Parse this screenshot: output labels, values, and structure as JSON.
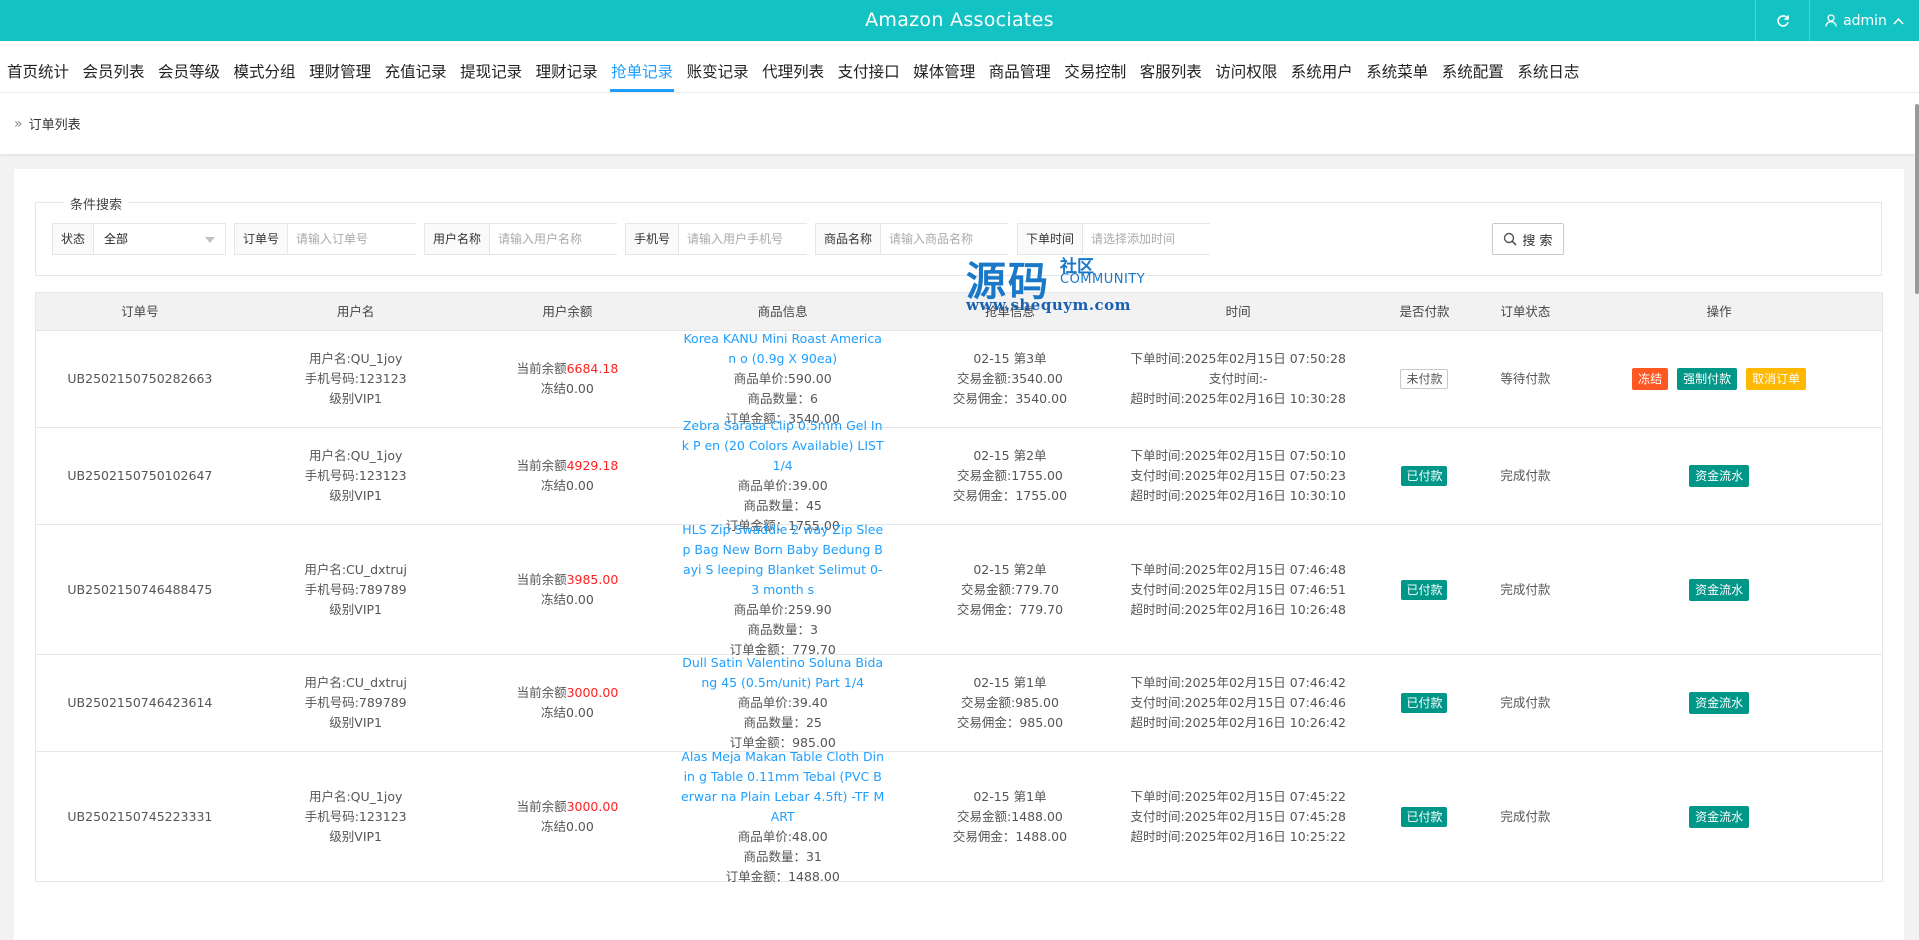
{
  "header": {
    "title": "Amazon Associates",
    "admin": "admin"
  },
  "nav": [
    {
      "label": "首页统计",
      "name": "nav-home-stats"
    },
    {
      "label": "会员列表",
      "name": "nav-member-list"
    },
    {
      "label": "会员等级",
      "name": "nav-member-level"
    },
    {
      "label": "模式分组",
      "name": "nav-mode-group"
    },
    {
      "label": "理财管理",
      "name": "nav-finance-manage"
    },
    {
      "label": "充值记录",
      "name": "nav-recharge-records"
    },
    {
      "label": "提现记录",
      "name": "nav-withdraw-records"
    },
    {
      "label": "理财记录",
      "name": "nav-finance-records"
    },
    {
      "label": "抢单记录",
      "name": "nav-grab-records",
      "active": true
    },
    {
      "label": "账变记录",
      "name": "nav-account-change"
    },
    {
      "label": "代理列表",
      "name": "nav-agent-list"
    },
    {
      "label": "支付接口",
      "name": "nav-payment-api"
    },
    {
      "label": "媒体管理",
      "name": "nav-media-manage"
    },
    {
      "label": "商品管理",
      "name": "nav-goods-manage"
    },
    {
      "label": "交易控制",
      "name": "nav-trade-control"
    },
    {
      "label": "客服列表",
      "name": "nav-service-list"
    },
    {
      "label": "访问权限",
      "name": "nav-access-rights"
    },
    {
      "label": "系统用户",
      "name": "nav-system-users"
    },
    {
      "label": "系统菜单",
      "name": "nav-system-menu"
    },
    {
      "label": "系统配置",
      "name": "nav-system-config"
    },
    {
      "label": "系统日志",
      "name": "nav-system-log"
    }
  ],
  "breadcrumb": "订单列表",
  "search": {
    "legend": "条件搜索",
    "status_label": "状态",
    "status_value": "全部",
    "order_label": "订单号",
    "order_placeholder": "请输入订单号",
    "username_label": "用户名称",
    "username_placeholder": "请输入用户名称",
    "phone_label": "手机号",
    "phone_placeholder": "请输入用户手机号",
    "goods_label": "商品名称",
    "goods_placeholder": "请输入商品名称",
    "time_label": "下单时间",
    "time_placeholder": "请选择添加时间",
    "button": "搜 索"
  },
  "table": {
    "headers": [
      "订单号",
      "用户名",
      "用户余额",
      "商品信息",
      "抢单信息",
      "时间",
      "是否付款",
      "订单状态",
      "操作"
    ],
    "rows": [
      {
        "order_no": "UB2502150750282663",
        "user": [
          "用户名:QU_1joy",
          "手机号码:123123",
          "级别VIP1"
        ],
        "balance_prefix": "当前余额",
        "balance": "6684.18",
        "frozen": "冻结0.00",
        "goods_name": "Korea KANU Mini Roast American o (0.9g X 90ea)",
        "goods_info": [
          "商品单价:590.00",
          "商品数量：6",
          "订单金额：3540.00"
        ],
        "grab": [
          "02-15 第3单",
          "交易金额:3540.00",
          "交易佣金：3540.00"
        ],
        "time": [
          "下单时间:2025年02月15日 07:50:28",
          "支付时间:-",
          "超时时间:2025年02月16日 10:30:28"
        ],
        "paid": "未付款",
        "paid_style": "outline",
        "status": "等待付款",
        "ops": [
          {
            "label": "冻结",
            "style": "red"
          },
          {
            "label": "强制付款",
            "style": "green"
          },
          {
            "label": "取消订单",
            "style": "yellow"
          }
        ],
        "height": 97
      },
      {
        "order_no": "UB2502150750102647",
        "user": [
          "用户名:QU_1joy",
          "手机号码:123123",
          "级别VIP1"
        ],
        "balance_prefix": "当前余额",
        "balance": "4929.18",
        "frozen": "冻结0.00",
        "goods_name": "Zebra Sarasa Clip 0.5mm Gel Ink P en (20 Colors Available) LIST 1/4",
        "goods_info": [
          "商品单价:39.00",
          "商品数量：45",
          "订单金额：1755.00"
        ],
        "grab": [
          "02-15 第2单",
          "交易金额:1755.00",
          "交易佣金：1755.00"
        ],
        "time": [
          "下单时间:2025年02月15日 07:50:10",
          "支付时间:2025年02月15日 07:50:23",
          "超时时间:2025年02月16日 10:30:10"
        ],
        "paid": "已付款",
        "paid_style": "green",
        "status": "完成付款",
        "ops": [
          {
            "label": "资金流水",
            "style": "green"
          }
        ],
        "height": 97
      },
      {
        "order_no": "UB2502150746488475",
        "user": [
          "用户名:CU_dxtruj",
          "手机号码:789789",
          "级别VIP1"
        ],
        "balance_prefix": "当前余额",
        "balance": "3985.00",
        "frozen": "冻结0.00",
        "goods_name": "HLS Zip Swaddle 2 way Zip Sleep Bag New Born Baby Bedung Bayi S leeping Blanket Selimut 0-3 month s",
        "goods_info": [
          "商品单价:259.90",
          "商品数量：3",
          "订单金额：779.70"
        ],
        "grab": [
          "02-15 第2单",
          "交易金额:779.70",
          "交易佣金：779.70"
        ],
        "time": [
          "下单时间:2025年02月15日 07:46:48",
          "支付时间:2025年02月15日 07:46:51",
          "超时时间:2025年02月16日 10:26:48"
        ],
        "paid": "已付款",
        "paid_style": "green",
        "status": "完成付款",
        "ops": [
          {
            "label": "资金流水",
            "style": "green"
          }
        ],
        "height": 130
      },
      {
        "order_no": "UB2502150746423614",
        "user": [
          "用户名:CU_dxtruj",
          "手机号码:789789",
          "级别VIP1"
        ],
        "balance_prefix": "当前余额",
        "balance": "3000.00",
        "frozen": "冻结0.00",
        "goods_name": "Dull Satin Valentino Soluna Bidang 45 (0.5m/unit) Part 1/4",
        "goods_info": [
          "商品单价:39.40",
          "商品数量：25",
          "订单金额：985.00"
        ],
        "grab": [
          "02-15 第1单",
          "交易金额:985.00",
          "交易佣金：985.00"
        ],
        "time": [
          "下单时间:2025年02月15日 07:46:42",
          "支付时间:2025年02月15日 07:46:46",
          "超时时间:2025年02月16日 10:26:42"
        ],
        "paid": "已付款",
        "paid_style": "green",
        "status": "完成付款",
        "ops": [
          {
            "label": "资金流水",
            "style": "green"
          }
        ],
        "height": 97
      },
      {
        "order_no": "UB2502150745223331",
        "user": [
          "用户名:QU_1joy",
          "手机号码:123123",
          "级别VIP1"
        ],
        "balance_prefix": "当前余额",
        "balance": "3000.00",
        "frozen": "冻结0.00",
        "goods_name": "Alas Meja Makan Table Cloth Dinin g Table 0.11mm Tebal (PVC Berwar na Plain Lebar 4.5ft) -TF MART",
        "goods_info": [
          "商品单价:48.00",
          "商品数量：31",
          "订单金额：1488.00"
        ],
        "grab": [
          "02-15 第1单",
          "交易金额:1488.00",
          "交易佣金：1488.00"
        ],
        "time": [
          "下单时间:2025年02月15日 07:45:22",
          "支付时间:2025年02月15日 07:45:28",
          "超时时间:2025年02月16日 10:25:22"
        ],
        "paid": "已付款",
        "paid_style": "green",
        "status": "完成付款",
        "ops": [
          {
            "label": "资金流水",
            "style": "green"
          }
        ],
        "height": 130
      }
    ]
  },
  "watermark": {
    "cn_main": "源码",
    "cn_sub": "社区",
    "en": "COMMUNITY",
    "url": "www.shequym.com"
  },
  "colors": {
    "topbar": "#13c2c2",
    "active_nav": "#1e9fff",
    "link": "#1e9fff",
    "balance_red": "#ff2020",
    "green": "#009688",
    "orange": "#ff5722",
    "yellow": "#ffb800"
  }
}
